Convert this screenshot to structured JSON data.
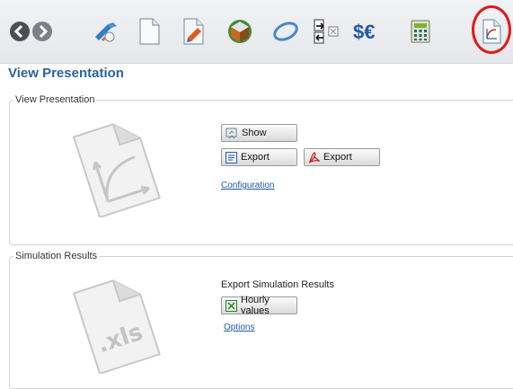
{
  "toolbar": {
    "items": [
      {
        "icon": "back-arrow-icon"
      },
      {
        "icon": "forward-arrow-icon"
      },
      {
        "icon": "pv-system-icon"
      },
      {
        "icon": "blank-document-icon"
      },
      {
        "icon": "edit-document-icon"
      },
      {
        "icon": "3d-model-icon"
      },
      {
        "icon": "orbit-icon"
      },
      {
        "icon": "import-export-icon"
      },
      {
        "icon": "currency-icon"
      },
      {
        "icon": "calculator-icon"
      },
      {
        "icon": "presentation-icon"
      }
    ],
    "active": "presentation-icon",
    "highlight_color": "#e0191c"
  },
  "page": {
    "title": "View Presentation"
  },
  "presentation": {
    "legend": "View Presentation",
    "show_label": "Show",
    "export_label": "Export",
    "export_pdf_label": "Export",
    "configuration_link": "Configuration"
  },
  "simulation": {
    "legend": "Simulation Results",
    "heading": "Export Simulation Results",
    "hourly_label": "Hourly values",
    "options_link": "Options",
    "file_icon_text": ".xls"
  },
  "colors": {
    "title": "#2d62a1",
    "link": "#1f5aa6"
  }
}
